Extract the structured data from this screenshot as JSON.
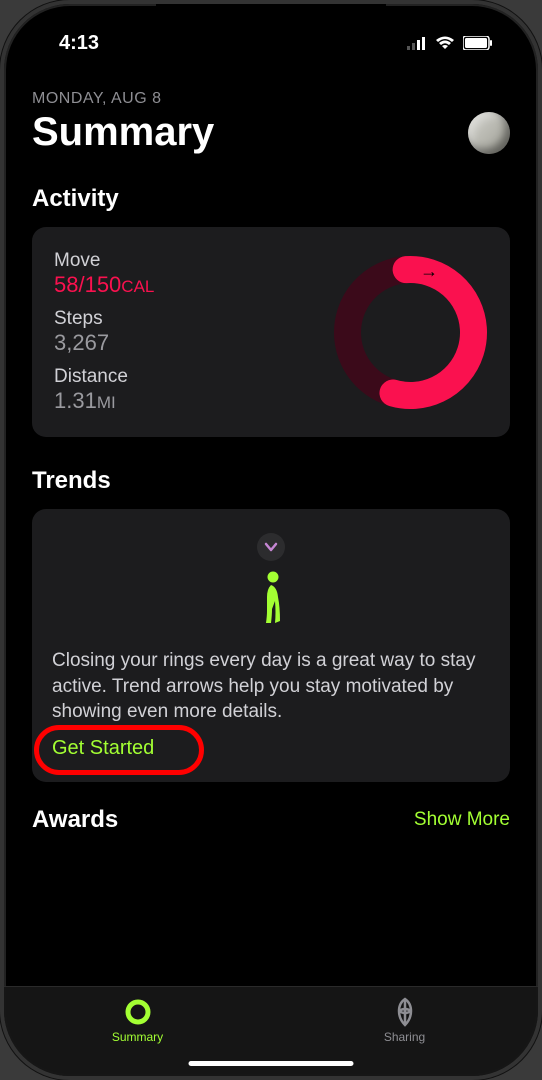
{
  "status": {
    "time": "4:13"
  },
  "header": {
    "date": "MONDAY, AUG 8",
    "title": "Summary"
  },
  "activity": {
    "section_title": "Activity",
    "move_label": "Move",
    "move_value": "58/150",
    "move_unit": "CAL",
    "steps_label": "Steps",
    "steps_value": "3,267",
    "distance_label": "Distance",
    "distance_value": "1.31",
    "distance_unit": "MI",
    "ring_progress_pct": 39
  },
  "trends": {
    "section_title": "Trends",
    "body": "Closing your rings every day is a great way to stay active. Trend arrows help you stay motivated by showing even more details.",
    "cta": "Get Started"
  },
  "awards": {
    "section_title": "Awards",
    "show_more": "Show More"
  },
  "tabs": {
    "summary": "Summary",
    "sharing": "Sharing"
  },
  "colors": {
    "accent_green": "#a3ff33",
    "move_red": "#fa114f"
  }
}
